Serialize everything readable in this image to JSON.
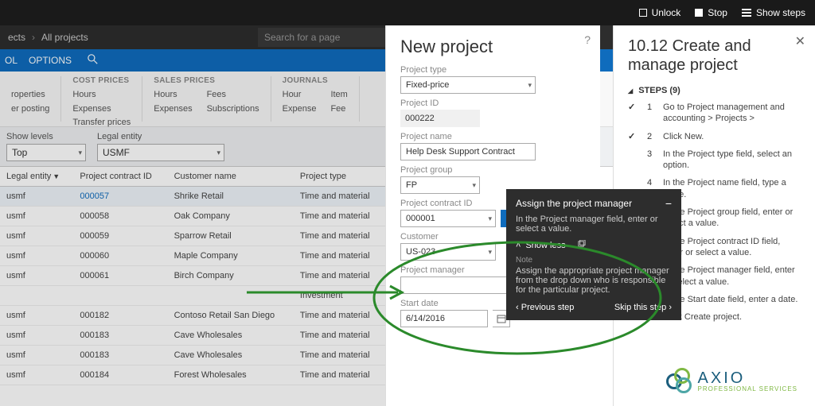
{
  "topbar": {
    "unlock": "Unlock",
    "stop": "Stop",
    "show_steps": "Show steps"
  },
  "breadcrumb": {
    "item1": "ects",
    "item2": "All projects",
    "search_placeholder": "Search for a page"
  },
  "ribbon": {
    "item1": "OL",
    "item2": "OPTIONS"
  },
  "menu_groups": [
    {
      "title": "",
      "cols": [
        [
          "roperties",
          "er posting"
        ]
      ]
    },
    {
      "title": "COST PRICES",
      "cols": [
        [
          "Hours",
          "Expenses",
          "Transfer prices"
        ]
      ]
    },
    {
      "title": "SALES PRICES",
      "cols": [
        [
          "Hours",
          "Expenses"
        ],
        [
          "Fees",
          "Subscriptions"
        ]
      ]
    },
    {
      "title": "JOURNALS",
      "cols": [
        [
          "Hour",
          "Expense"
        ],
        [
          "Item",
          "Fee"
        ]
      ]
    }
  ],
  "filters": {
    "show_levels_label": "Show levels",
    "show_levels_value": "Top",
    "legal_entity_label": "Legal entity",
    "legal_entity_value": "USMF"
  },
  "table": {
    "headers": [
      "Legal entity",
      "Project contract ID",
      "Customer name",
      "Project type"
    ],
    "rows": [
      {
        "entity": "usmf",
        "contract": "000057",
        "customer": "Shrike Retail",
        "type": "Time and material",
        "link": true,
        "selected": true
      },
      {
        "entity": "usmf",
        "contract": "000058",
        "customer": "Oak Company",
        "type": "Time and material"
      },
      {
        "entity": "usmf",
        "contract": "000059",
        "customer": "Sparrow Retail",
        "type": "Time and material"
      },
      {
        "entity": "usmf",
        "contract": "000060",
        "customer": "Maple Company",
        "type": "Time and material"
      },
      {
        "entity": "usmf",
        "contract": "000061",
        "customer": "Birch Company",
        "type": "Time and material"
      },
      {
        "entity": "",
        "contract": "",
        "customer": "",
        "type": "Investment"
      },
      {
        "entity": "usmf",
        "contract": "000182",
        "customer": "Contoso Retail San Diego",
        "type": "Time and material"
      },
      {
        "entity": "usmf",
        "contract": "000183",
        "customer": "Cave Wholesales",
        "type": "Time and material"
      },
      {
        "entity": "usmf",
        "contract": "000183",
        "customer": "Cave Wholesales",
        "type": "Time and material"
      },
      {
        "entity": "usmf",
        "contract": "000184",
        "customer": "Forest Wholesales",
        "type": "Time and material"
      }
    ]
  },
  "new_project": {
    "title": "New project",
    "project_type_label": "Project type",
    "project_type_value": "Fixed-price",
    "project_id_label": "Project ID",
    "project_id_value": "000222",
    "project_name_label": "Project name",
    "project_name_value": "Help Desk Support Contract",
    "project_group_label": "Project group",
    "project_group_value": "FP",
    "project_contract_id_label": "Project contract ID",
    "project_contract_id_value": "000001",
    "customer_label": "Customer",
    "customer_value": "US-023",
    "project_manager_label": "Project manager",
    "project_manager_value": "",
    "start_date_label": "Start date",
    "start_date_value": "6/14/2016"
  },
  "popup": {
    "title": "Assign the project manager",
    "msg": "In the Project manager field, enter or select a value.",
    "show_less": "Show less",
    "note_label": "Note",
    "note_text": "Assign the appropriate project manager from the drop down who is responsible for the particular project.",
    "prev": "Previous step",
    "skip": "Skip this step"
  },
  "steps_panel": {
    "title": "10.12 Create and manage project",
    "header": "STEPS (9)",
    "steps": [
      {
        "done": true,
        "num": "1",
        "txt": "Go to Project management and accounting > Projects >"
      },
      {
        "done": true,
        "num": "2",
        "txt": "Click New."
      },
      {
        "done": false,
        "num": "3",
        "txt": "In the Project type field, select an option."
      },
      {
        "done": false,
        "num": "4",
        "txt": "In the Project name field, type a value."
      },
      {
        "done": false,
        "num": "",
        "txt": "In the Project group field, enter or select a value."
      },
      {
        "done": false,
        "num": "",
        "txt": "In the Project contract ID field, enter or select a value."
      },
      {
        "done": false,
        "num": "",
        "txt": "In the Project manager field, enter or select a value."
      },
      {
        "done": false,
        "num": "",
        "txt": "In the Start date field, enter a date."
      },
      {
        "done": false,
        "num": "",
        "txt": "Click Create project."
      }
    ]
  },
  "logo": {
    "main": "AXIO",
    "sub": "PROFESSIONAL SERVICES"
  }
}
